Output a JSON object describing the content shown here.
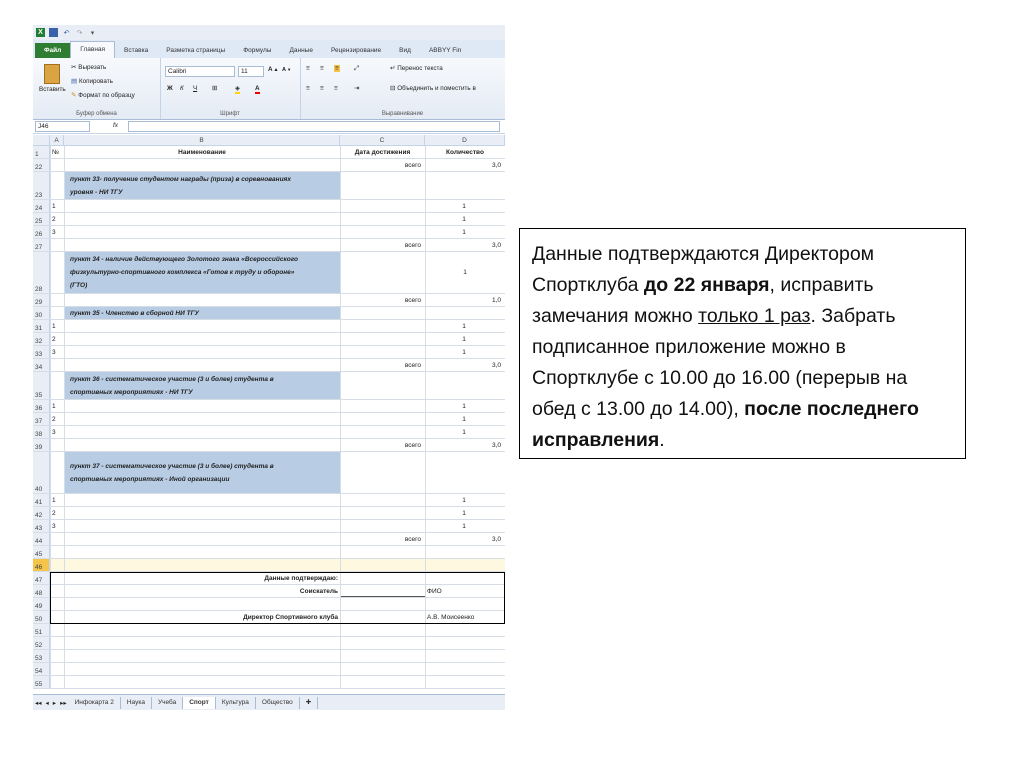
{
  "window": {
    "qat_icons": [
      "excel-logo",
      "save-icon",
      "undo-icon",
      "redo-icon",
      "customize-icon"
    ],
    "tabs": [
      "Файл",
      "Главная",
      "Вставка",
      "Разметка страницы",
      "Формулы",
      "Данные",
      "Рецензирование",
      "Вид",
      "ABBYY Fin"
    ]
  },
  "ribbon": {
    "clipboard": {
      "paste": "Вставить",
      "cut": "Вырезать",
      "copy": "Копировать",
      "format_painter": "Формат по образцу",
      "label": "Буфер обмена"
    },
    "font": {
      "name": "Calibri",
      "size": "11",
      "bold": "Ж",
      "italic": "К",
      "underline": "Ч",
      "label": "Шрифт"
    },
    "alignment": {
      "wrap": "Перенос текста",
      "merge": "Объединить и поместить в",
      "label": "Выравнивание"
    }
  },
  "formula_bar": {
    "cell_ref": "J46",
    "fx": "fx"
  },
  "columns": [
    {
      "key": "rownum",
      "label": ""
    },
    {
      "key": "A",
      "label": "A"
    },
    {
      "key": "B",
      "label": "B"
    },
    {
      "key": "C",
      "label": "C"
    },
    {
      "key": "D",
      "label": "D"
    }
  ],
  "rows": [
    {
      "n": "1",
      "a": "№",
      "b": "Наименование",
      "c": "Дата достижения",
      "d": "Количество",
      "type": "header"
    },
    {
      "n": "22",
      "a": "",
      "b": "",
      "c": "всего",
      "d": "3,0"
    },
    {
      "n": "23",
      "a": "",
      "b": "пункт 33- получение студентом награды (приза) в соревнованиях уровня - НИ ТГУ",
      "c": "",
      "d": "",
      "type": "section",
      "h": 28
    },
    {
      "n": "24",
      "a": "1",
      "b": "",
      "c": "",
      "d": "1"
    },
    {
      "n": "25",
      "a": "2",
      "b": "",
      "c": "",
      "d": "1"
    },
    {
      "n": "26",
      "a": "3",
      "b": "",
      "c": "",
      "d": "1"
    },
    {
      "n": "27",
      "a": "",
      "b": "",
      "c": "всего",
      "d": "3,0"
    },
    {
      "n": "28",
      "a": "",
      "b": "пункт 34 - наличие действующего Золотого знака «Всероссийского физкультурно-спортивного комплекса «Готов к труду и обороне» (ГТО)",
      "c": "",
      "d": "1",
      "type": "section",
      "h": 42
    },
    {
      "n": "29",
      "a": "",
      "b": "",
      "c": "всего",
      "d": "1,0"
    },
    {
      "n": "30",
      "a": "",
      "b": "пункт 35 - Членство в сборной НИ ТГУ",
      "c": "",
      "d": "",
      "type": "section"
    },
    {
      "n": "31",
      "a": "1",
      "b": "",
      "c": "",
      "d": "1"
    },
    {
      "n": "32",
      "a": "2",
      "b": "",
      "c": "",
      "d": "1"
    },
    {
      "n": "33",
      "a": "3",
      "b": "",
      "c": "",
      "d": "1"
    },
    {
      "n": "34",
      "a": "",
      "b": "",
      "c": "всего",
      "d": "3,0"
    },
    {
      "n": "35",
      "a": "",
      "b": "пункт 36 - систематическое участие (3 и более) студента в спортивных мероприятиях - НИ ТГУ",
      "c": "",
      "d": "",
      "type": "section",
      "h": 28
    },
    {
      "n": "36",
      "a": "1",
      "b": "",
      "c": "",
      "d": "1"
    },
    {
      "n": "37",
      "a": "2",
      "b": "",
      "c": "",
      "d": "1"
    },
    {
      "n": "38",
      "a": "3",
      "b": "",
      "c": "",
      "d": "1"
    },
    {
      "n": "39",
      "a": "",
      "b": "",
      "c": "всего",
      "d": "3,0"
    },
    {
      "n": "40",
      "a": "",
      "b": "пункт 37 - систематическое участие (3 и более) студента в спортивных мероприятиях - Иной организации",
      "c": "",
      "d": "",
      "type": "section",
      "h": 42
    },
    {
      "n": "41",
      "a": "1",
      "b": "",
      "c": "",
      "d": "1"
    },
    {
      "n": "42",
      "a": "2",
      "b": "",
      "c": "",
      "d": "1"
    },
    {
      "n": "43",
      "a": "3",
      "b": "",
      "c": "",
      "d": "1"
    },
    {
      "n": "44",
      "a": "",
      "b": "",
      "c": "всего",
      "d": "3,0"
    },
    {
      "n": "45",
      "a": "",
      "b": "",
      "c": "",
      "d": ""
    },
    {
      "n": "46",
      "a": "",
      "b": "",
      "c": "",
      "d": "",
      "type": "selected"
    },
    {
      "n": "47",
      "a": "",
      "b": "Данные подтверждаю:",
      "c": "",
      "d": "",
      "type": "sig"
    },
    {
      "n": "48",
      "a": "",
      "b": "Соискатель",
      "c": "",
      "d": "ФИО",
      "type": "sig"
    },
    {
      "n": "49",
      "a": "",
      "b": "",
      "c": "",
      "d": "",
      "type": "sig"
    },
    {
      "n": "50",
      "a": "",
      "b": "Директор Спортивного клуба",
      "c": "",
      "d": "А.В. Моисеенко",
      "type": "sig"
    },
    {
      "n": "51",
      "a": "",
      "b": "",
      "c": "",
      "d": ""
    },
    {
      "n": "52",
      "a": "",
      "b": "",
      "c": "",
      "d": ""
    },
    {
      "n": "53",
      "a": "",
      "b": "",
      "c": "",
      "d": ""
    },
    {
      "n": "54",
      "a": "",
      "b": "",
      "c": "",
      "d": ""
    },
    {
      "n": "55",
      "a": "",
      "b": "",
      "c": "",
      "d": ""
    }
  ],
  "sheet_tabs": [
    "Инфокарта 2",
    "Наука",
    "Учеба",
    "Спорт",
    "Культура",
    "Общество"
  ],
  "active_sheet": "Спорт",
  "note": {
    "p1": "Данные подтверждаются Директором Спортклуба ",
    "p1_bold": "до 22 января",
    "p2": ", исправить замечания можно ",
    "p2_underline": "только 1 раз",
    "p3": ". Забрать подписанное приложение можно в Спортклубе с 10.00 до 16.00 (перерыв на обед с 13.00 до 14.00), ",
    "p3_bold": "после последнего исправления",
    "p4": "."
  }
}
